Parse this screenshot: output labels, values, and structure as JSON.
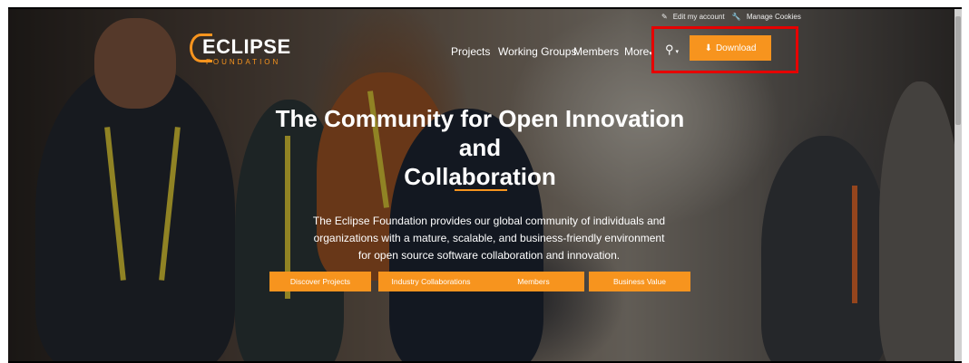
{
  "utility_links": {
    "edit_account": "Edit my account",
    "manage_cookies": "Manage Cookies"
  },
  "logo": {
    "name": "ECLIPSE",
    "sub": "FOUNDATION"
  },
  "nav": {
    "projects": "Projects",
    "working_groups": "Working Groups",
    "members": "Members",
    "more": "More"
  },
  "icons": {
    "search": "search-icon",
    "download": "download-icon",
    "edit": "edit-icon",
    "wrench": "wrench-icon"
  },
  "download_button": "Download",
  "hero": {
    "headline_line1": "The Community for Open Innovation and",
    "headline_line2": "Collaboration",
    "desc_line1": "The Eclipse Foundation provides our global community of individuals and",
    "desc_line2": "organizations with a mature, scalable, and business-friendly environment",
    "desc_line3": "for open source software collaboration and innovation."
  },
  "cta": {
    "discover": "Discover Projects",
    "industry": "Industry Collaborations",
    "members": "Members",
    "business": "Business Value"
  },
  "colors": {
    "accent": "#f7941e",
    "highlight": "#e60000"
  }
}
